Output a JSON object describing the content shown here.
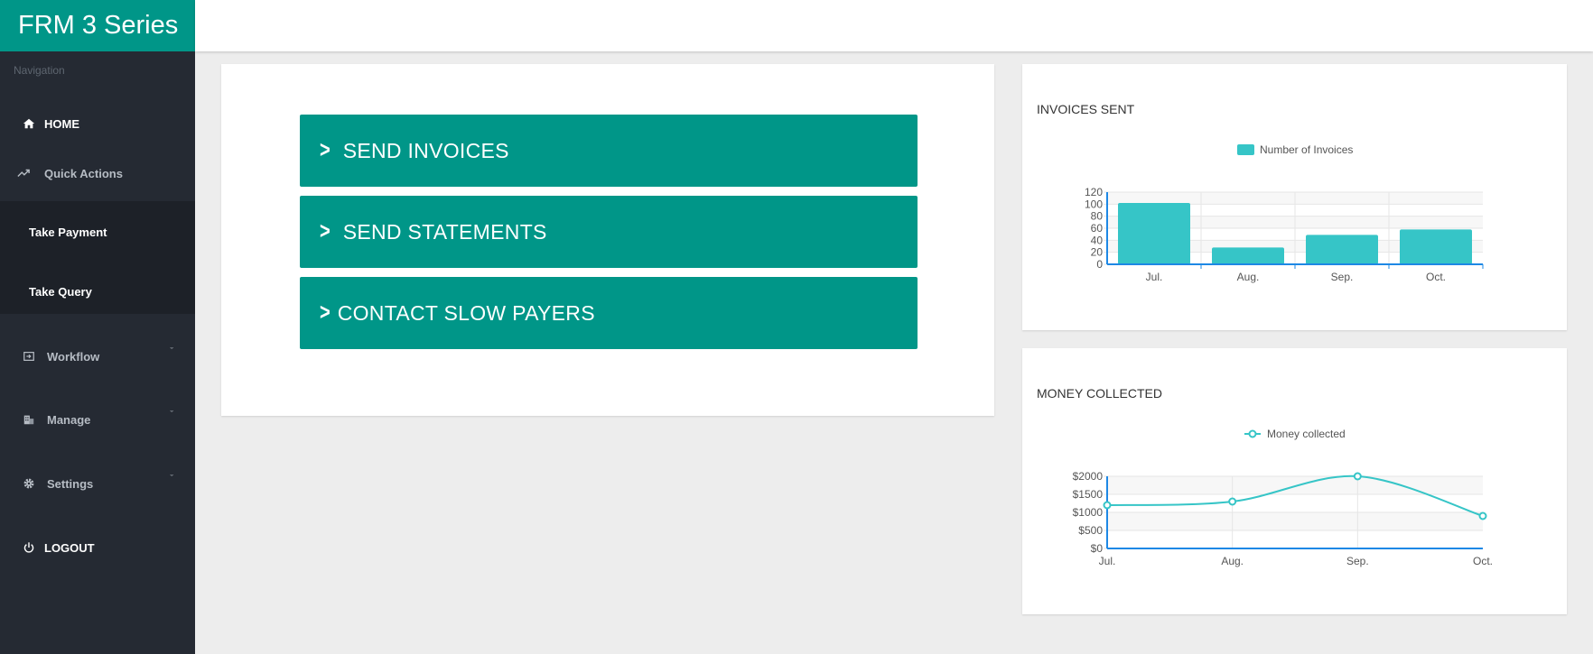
{
  "app": {
    "title": "FRM 3 Series"
  },
  "sidebar": {
    "heading": "Navigation",
    "home": "HOME",
    "quick_actions": "Quick Actions",
    "quick_items": [
      "Take Payment",
      "Take Query"
    ],
    "workflow": "Workflow",
    "manage": "Manage",
    "settings": "Settings",
    "logout": "LOGOUT",
    "chevron_glyph": "ˇ"
  },
  "actions": {
    "arrow_glyph": ">",
    "buttons": [
      "SEND INVOICES",
      "SEND STATEMENTS",
      "CONTACT SLOW PAYERS"
    ]
  },
  "colors": {
    "brand": "#009688",
    "chart": "#36c5c7",
    "sidebar": "#252a33",
    "axis": "#1e88e5"
  },
  "chart_data": [
    {
      "type": "bar",
      "title": "INVOICES SENT",
      "categories": [
        "Jul.",
        "Aug.",
        "Sep.",
        "Oct."
      ],
      "series": [
        {
          "name": "Number of Invoices",
          "values": [
            102,
            28,
            49,
            58
          ]
        }
      ],
      "ylim": [
        0,
        120
      ],
      "yticks": [
        0,
        20,
        40,
        60,
        80,
        100,
        120
      ],
      "grid": true,
      "legend": "top-center"
    },
    {
      "type": "line",
      "title": "MONEY COLLECTED",
      "categories": [
        "Jul.",
        "Aug.",
        "Sep.",
        "Oct."
      ],
      "series": [
        {
          "name": "Money collected",
          "values": [
            1200,
            1300,
            2000,
            900
          ]
        }
      ],
      "ylim": [
        0,
        2000
      ],
      "yticks": [
        0,
        500,
        1000,
        1500,
        2000
      ],
      "ytick_labels": [
        "$0",
        "$500",
        "$1000",
        "$1500",
        "$2000"
      ],
      "grid": true,
      "legend": "top-center"
    }
  ]
}
